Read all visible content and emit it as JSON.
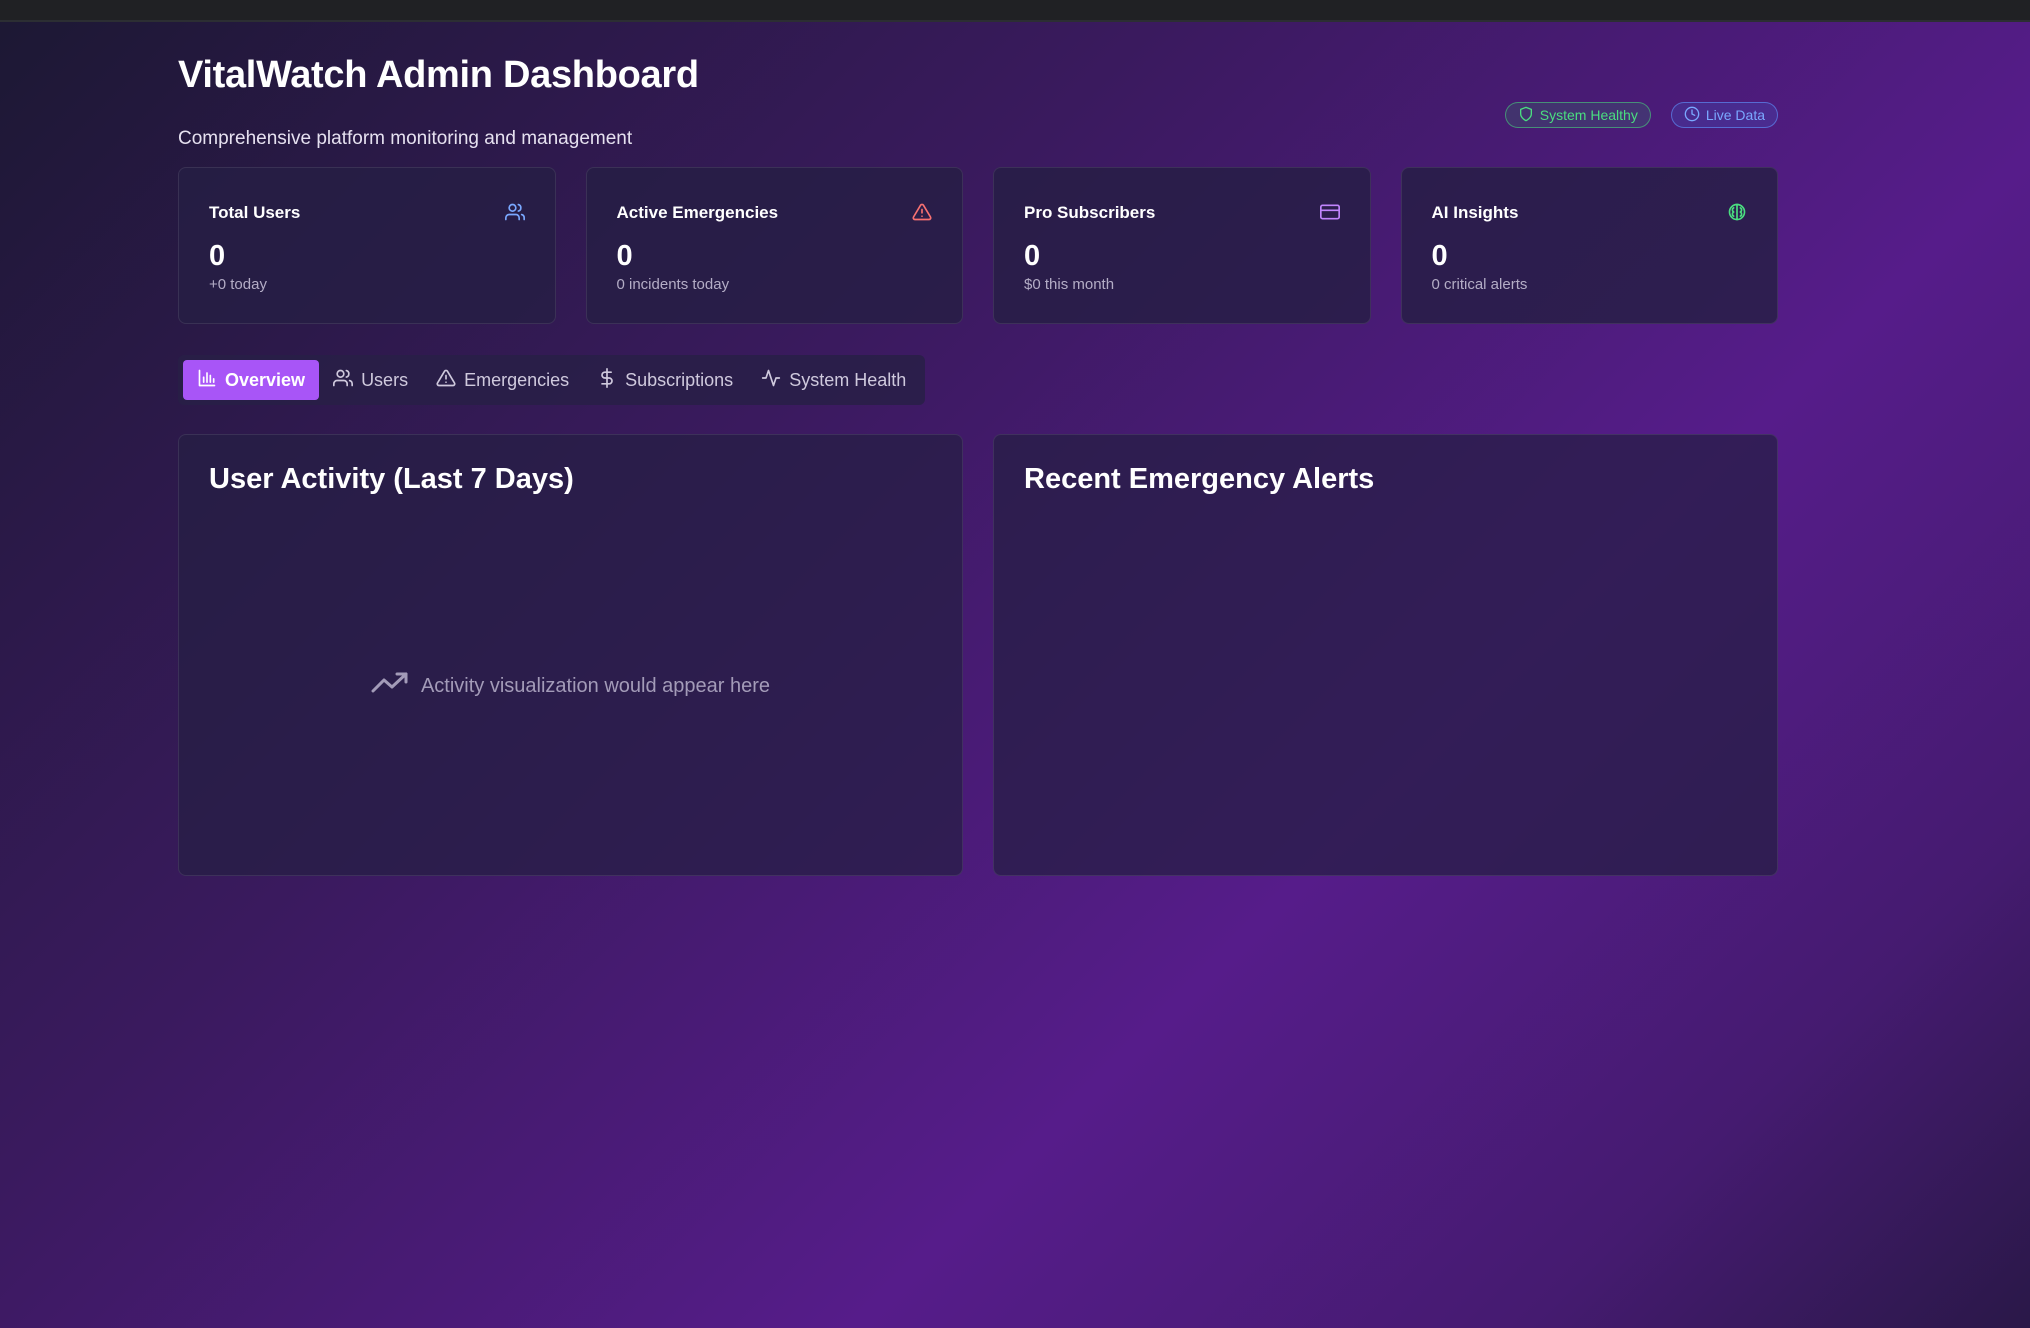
{
  "header": {
    "title": "VitalWatch Admin Dashboard",
    "subtitle": "Comprehensive platform monitoring and management",
    "badges": [
      {
        "label": "System Healthy",
        "icon": "shield-icon",
        "color": "#4ade80"
      },
      {
        "label": "Live Data",
        "icon": "clock-icon",
        "color": "#7aa8ff"
      }
    ]
  },
  "stats": [
    {
      "label": "Total Users",
      "value": "0",
      "sub": "+0 today",
      "icon": "users-icon",
      "color": "#7aa8ff"
    },
    {
      "label": "Active Emergencies",
      "value": "0",
      "sub": "0 incidents today",
      "icon": "alert-triangle-icon",
      "color": "#f87171"
    },
    {
      "label": "Pro Subscribers",
      "value": "0",
      "sub": "$0 this month",
      "icon": "credit-card-icon",
      "color": "#c084fc"
    },
    {
      "label": "AI Insights",
      "value": "0",
      "sub": "0 critical alerts",
      "icon": "brain-icon",
      "color": "#4ade80"
    }
  ],
  "tabs": [
    {
      "label": "Overview",
      "icon": "bar-chart-icon",
      "active": true
    },
    {
      "label": "Users",
      "icon": "users-icon",
      "active": false
    },
    {
      "label": "Emergencies",
      "icon": "alert-triangle-icon",
      "active": false
    },
    {
      "label": "Subscriptions",
      "icon": "dollar-icon",
      "active": false
    },
    {
      "label": "System Health",
      "icon": "activity-icon",
      "active": false
    }
  ],
  "panels": {
    "activity": {
      "title": "User Activity (Last 7 Days)",
      "placeholder": "Activity visualization would appear here",
      "icon": "trending-up-icon"
    },
    "alerts": {
      "title": "Recent Emergency Alerts"
    }
  },
  "colors": {
    "accent": "#a855f7"
  }
}
